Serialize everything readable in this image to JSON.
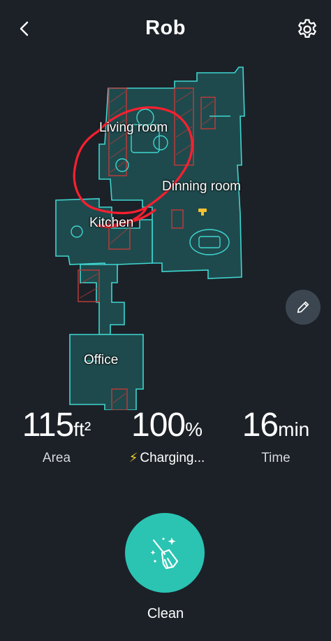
{
  "header": {
    "title": "Rob",
    "back_icon": "chevron-left-icon",
    "settings_icon": "gear-icon"
  },
  "map": {
    "rooms": [
      {
        "key": "living",
        "label": "Living room"
      },
      {
        "key": "dining",
        "label": "Dinning room"
      },
      {
        "key": "kitchen",
        "label": "Kitchen"
      },
      {
        "key": "office",
        "label": "Office"
      }
    ],
    "colors": {
      "wall": "#3fd6d0",
      "floor": "#1f4a4d",
      "no_go_zone": "#b83a3a",
      "annotation": "#ff1f2e",
      "dock": "#f2c230"
    },
    "edit_icon": "pencil-icon"
  },
  "stats": {
    "area": {
      "value": "115",
      "unit": "ft²",
      "label": "Area"
    },
    "battery": {
      "value": "100",
      "unit": "%",
      "status": "Charging...",
      "icon": "lightning-icon"
    },
    "time": {
      "value": "16",
      "unit": "min",
      "label": "Time"
    }
  },
  "action": {
    "label": "Clean",
    "icon": "broom-sparkle-icon",
    "color": "#2bc4b2"
  }
}
